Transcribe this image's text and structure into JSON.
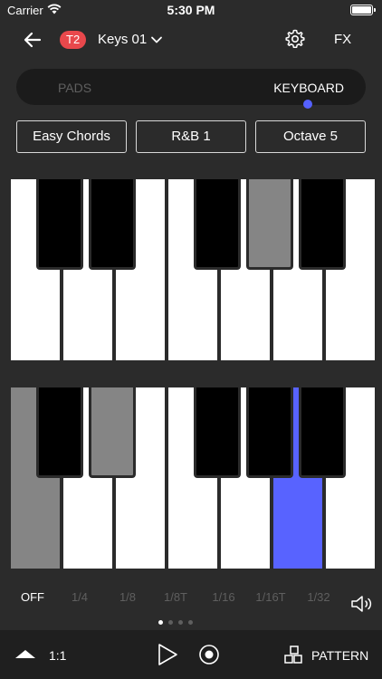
{
  "status_bar": {
    "carrier": "Carrier",
    "time": "5:30 PM"
  },
  "header": {
    "track_badge": "T2",
    "instrument": "Keys 01",
    "fx_label": "FX"
  },
  "mode_tabs": {
    "pads": "PADS",
    "keyboard": "KEYBOARD",
    "selected": "KEYBOARD"
  },
  "options": {
    "chord_mode": "Easy Chords",
    "chord_set": "R&B 1",
    "octave": "Octave 5"
  },
  "keyboard_top": {
    "white_keys": [
      "normal",
      "normal",
      "normal",
      "normal",
      "normal",
      "normal",
      "normal"
    ],
    "black_keys": [
      "normal",
      "normal",
      "normal",
      "highlighted",
      "normal"
    ]
  },
  "keyboard_bottom": {
    "white_keys": [
      "highlighted",
      "normal",
      "normal",
      "normal",
      "normal",
      "active",
      "normal"
    ],
    "black_keys": [
      "normal",
      "highlighted",
      "normal",
      "normal",
      "normal"
    ]
  },
  "note_repeat": {
    "rates": [
      "OFF",
      "1/4",
      "1/8",
      "1/8T",
      "1/16",
      "1/16T",
      "1/32"
    ],
    "selected": "OFF"
  },
  "pager": {
    "pages": 4,
    "current": 1
  },
  "transport": {
    "ratio": "1:1",
    "pattern_label": "PATTERN"
  },
  "colors": {
    "accent": "#5863ff",
    "badge": "#e8484c",
    "highlight_key": "#858585"
  }
}
